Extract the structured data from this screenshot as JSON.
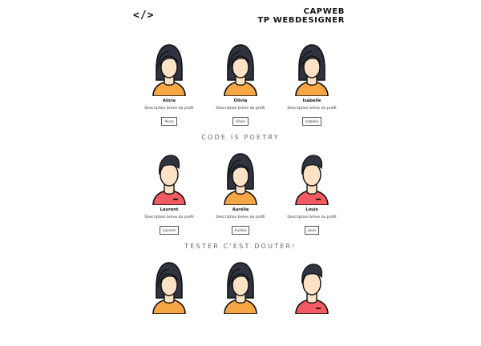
{
  "header": {
    "logo": "</>",
    "brand_line1": "CAPWEB",
    "brand_line2": "TP WEBDESIGNER"
  },
  "rows": [
    {
      "cards": [
        {
          "name": "Alicia",
          "desc": "Description brève du profil",
          "button": "Alicia",
          "avatar": "woman"
        },
        {
          "name": "Olivia",
          "desc": "Description brève du profil",
          "button": "Olivia",
          "avatar": "woman"
        },
        {
          "name": "Isabelle",
          "desc": "Description brève du profil",
          "button": "Isabelle",
          "avatar": "woman"
        }
      ]
    },
    {
      "cards": [
        {
          "name": "Laurent",
          "desc": "Description brève du profil",
          "button": "Laurent",
          "avatar": "man"
        },
        {
          "name": "Aurélie",
          "desc": "Description brève du profil",
          "button": "Aurélie",
          "avatar": "woman"
        },
        {
          "name": "Louis",
          "desc": "Description brève du profil",
          "button": "Louis",
          "avatar": "man"
        }
      ]
    },
    {
      "cards": [
        {
          "name": "",
          "desc": "",
          "button": "",
          "avatar": "woman"
        },
        {
          "name": "",
          "desc": "",
          "button": "",
          "avatar": "woman"
        },
        {
          "name": "",
          "desc": "",
          "button": "",
          "avatar": "man"
        }
      ]
    }
  ],
  "banners": {
    "b1": "CODE IS POETRY",
    "b2": "TESTER C'EST DOUTER!"
  },
  "colors": {
    "hair": "#2f3440",
    "skin": "#fde2c6",
    "woman_shirt": "#f7a646",
    "man_shirt": "#f15b61",
    "outline": "#111111"
  }
}
